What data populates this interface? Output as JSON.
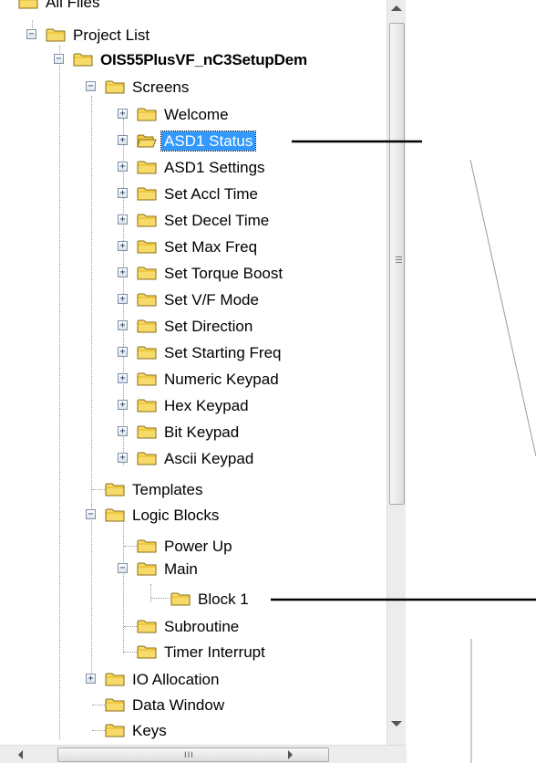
{
  "tree": {
    "nodes": [
      {
        "id": "all-files",
        "label": "All Files"
      },
      {
        "id": "project-list",
        "label": "Project List"
      },
      {
        "id": "project",
        "label": "OIS55PlusVF_nC3SetupDem"
      },
      {
        "id": "screens",
        "label": "Screens"
      },
      {
        "id": "welcome",
        "label": "Welcome"
      },
      {
        "id": "asd1-status",
        "label": "ASD1 Status",
        "selected": true
      },
      {
        "id": "asd1-settings",
        "label": "ASD1 Settings"
      },
      {
        "id": "set-accl-time",
        "label": "Set Accl Time"
      },
      {
        "id": "set-decel-time",
        "label": "Set Decel Time"
      },
      {
        "id": "set-max-freq",
        "label": "Set Max Freq"
      },
      {
        "id": "set-torque-boost",
        "label": "Set Torque Boost"
      },
      {
        "id": "set-vf-mode",
        "label": "Set V/F Mode"
      },
      {
        "id": "set-direction",
        "label": "Set Direction"
      },
      {
        "id": "set-starting-freq",
        "label": "Set Starting Freq"
      },
      {
        "id": "numeric-keypad",
        "label": "Numeric Keypad"
      },
      {
        "id": "hex-keypad",
        "label": "Hex Keypad"
      },
      {
        "id": "bit-keypad",
        "label": "Bit Keypad"
      },
      {
        "id": "ascii-keypad",
        "label": "Ascii Keypad"
      },
      {
        "id": "templates",
        "label": "Templates"
      },
      {
        "id": "logic-blocks",
        "label": "Logic Blocks"
      },
      {
        "id": "power-up",
        "label": "Power Up"
      },
      {
        "id": "main",
        "label": "Main"
      },
      {
        "id": "block-1",
        "label": "Block 1"
      },
      {
        "id": "subroutine",
        "label": "Subroutine"
      },
      {
        "id": "timer-interrupt",
        "label": "Timer Interrupt"
      },
      {
        "id": "io-allocation",
        "label": "IO Allocation"
      },
      {
        "id": "data-window",
        "label": "Data Window"
      },
      {
        "id": "keys",
        "label": "Keys"
      }
    ],
    "toggles": {
      "expanded": "−",
      "collapsed": "+"
    },
    "selection_color": "#3399ff",
    "folder_colors": {
      "fill": "#f6da6a",
      "tab": "#f0c840",
      "edge": "#8a6d12"
    }
  },
  "scrollbars": {
    "vertical": {
      "grip_icon": "grip-lines-icon",
      "up_icon": "arrow-up-icon",
      "down_icon": "arrow-down-icon"
    },
    "horizontal": {
      "grip_label": "III",
      "left_icon": "arrow-left-icon",
      "right_icon": "arrow-right-icon"
    }
  },
  "annotations": {
    "line_color": "#000000"
  }
}
